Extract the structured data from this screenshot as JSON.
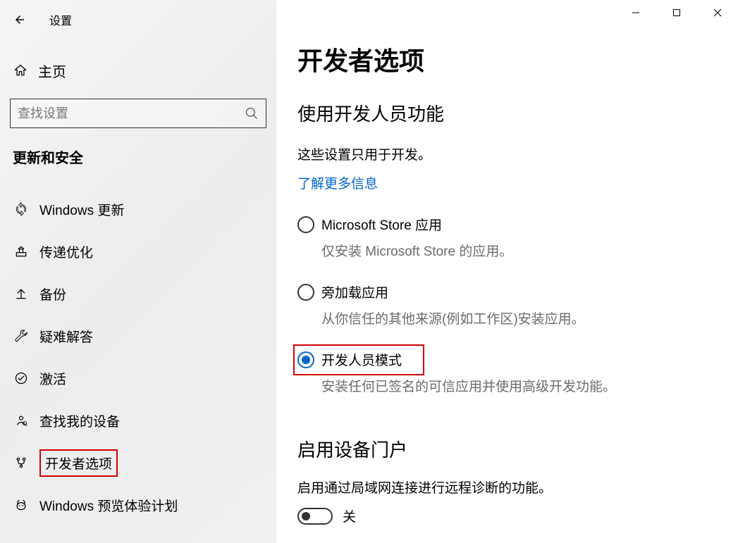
{
  "app": {
    "title": "设置"
  },
  "sidebar": {
    "home_label": "主页",
    "search_placeholder": "查找设置",
    "category": "更新和安全",
    "items": [
      {
        "label": "Windows 更新"
      },
      {
        "label": "传递优化"
      },
      {
        "label": "备份"
      },
      {
        "label": "疑难解答"
      },
      {
        "label": "激活"
      },
      {
        "label": "查找我的设备"
      },
      {
        "label": "开发者选项"
      },
      {
        "label": "Windows 预览体验计划"
      }
    ]
  },
  "main": {
    "page_title": "开发者选项",
    "section1_title": "使用开发人员功能",
    "section1_desc": "这些设置只用于开发。",
    "learn_more": "了解更多信息",
    "radios": [
      {
        "label": "Microsoft Store 应用",
        "desc": "仅安装 Microsoft Store 的应用。"
      },
      {
        "label": "旁加载应用",
        "desc": "从你信任的其他来源(例如工作区)安装应用。"
      },
      {
        "label": "开发人员模式",
        "desc": "安装任何已签名的可信应用并使用高级开发功能。"
      }
    ],
    "section2_title": "启用设备门户",
    "portal_desc": "启用通过局域网连接进行远程诊断的功能。",
    "toggle_label": "关"
  }
}
